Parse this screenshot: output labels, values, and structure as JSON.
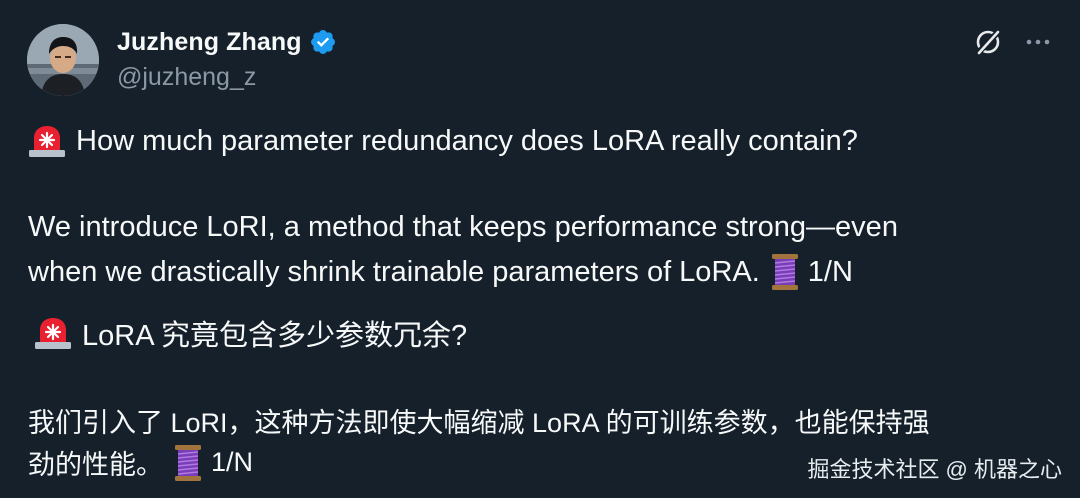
{
  "author": {
    "display_name": "Juzheng Zhang",
    "handle": "@juzheng_z",
    "verified": true
  },
  "icons": {
    "verified": "verified-badge-icon",
    "grok": "grok-icon",
    "more": "more-options-icon",
    "siren": "rotating-light-emoji",
    "thread": "thread-spool-emoji"
  },
  "tweet": {
    "en_line1": "How much parameter redundancy does LoRA really contain?",
    "en_line2": "We introduce LoRI, a method that keeps performance strong—even",
    "en_line3": "when we drastically shrink trainable parameters of LoRA.",
    "en_counter": "1/N",
    "zh_line1": "LoRA 究竟包含多少参数冗余?",
    "zh_line2": "我们引入了 LoRI，这种方法即使大幅缩减 LoRA 的可训练参数，也能保持强",
    "zh_line3": "劲的性能。",
    "zh_counter": "1/N"
  },
  "watermark": "掘金技术社区 @ 机器之心",
  "colors": {
    "background": "#15202b",
    "text": "#f7f9f9",
    "muted": "#8b98a5",
    "verified_blue": "#1d9bf0"
  }
}
